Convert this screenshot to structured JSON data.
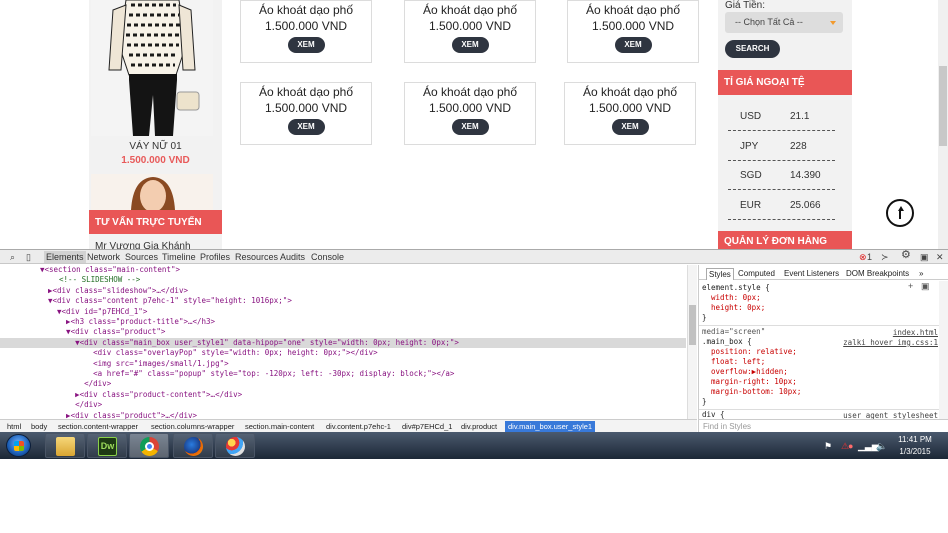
{
  "page": {
    "left_product": {
      "name": "VÁY NỮ 01",
      "price": "1.500.000 VND"
    },
    "left_banner": "TƯ VẤN TRỰC TUYẾN",
    "support_name": "Mr Vương Gia Khánh",
    "cards": [
      {
        "name": "Áo khoát dạo phố",
        "price": "1.500.000 VND",
        "button": "XEM"
      },
      {
        "name": "Áo khoát dạo phố",
        "price": "1.500.000 VND",
        "button": "XEM"
      },
      {
        "name": "Áo khoát dạo phố",
        "price": "1.500.000 VND",
        "button": "XEM"
      },
      {
        "name": "Áo khoát dạo phố",
        "price": "1.500.000 VND",
        "button": "XEM"
      },
      {
        "name": "Áo khoát dạo phố",
        "price": "1.500.000 VND",
        "button": "XEM"
      },
      {
        "name": "Áo khoát dạo phố",
        "price": "1.500.000 VND",
        "button": "XEM"
      }
    ],
    "price_filter": {
      "label": "Giá Tiền:",
      "select_value": "-- Chọn Tất Cả --",
      "search_button": "SEARCH"
    },
    "rates_banner": "TỈ GIÁ NGOẠI TỆ",
    "rates": [
      {
        "code": "USD",
        "value": "21.1"
      },
      {
        "code": "JPY",
        "value": "228"
      },
      {
        "code": "SGD",
        "value": "14.390"
      },
      {
        "code": "EUR",
        "value": "25.066"
      }
    ],
    "orders_banner": "QUẢN LÝ ĐƠN HÀNG",
    "accent_color": "#e95656"
  },
  "devtools": {
    "tabs": [
      "Elements",
      "Network",
      "Sources",
      "Timeline",
      "Profiles",
      "Resources",
      "Audits",
      "Console"
    ],
    "active_tab": "Elements",
    "error_count": "1",
    "dom_lines": [
      "▼<section class=\"main-content\">",
      "  <!-- SLIDESHOW -->",
      "▶<div class=\"slideshow\">…</div>",
      "▼<div class=\"content p7ehc-1\" style=\"height: 1016px;\">",
      "  ▼<div id=\"p7EHCd_1\">",
      "    ▶<h3 class=\"product-title\">…</h3>",
      "    ▼<div class=\"product\">",
      "      ▼<div class=\"main_box user_style1\" data-hipop=\"one\" style=\"width: 0px; height: 0px;\">",
      "          <div class=\"overlayPop\" style=\"width: 0px; height: 0px;\"></div>",
      "          <img src=\"images/small/1.jpg\">",
      "          <a href=\"#\" class=\"popup\" style=\"top: -120px; left: -30px; display: block;\"></a>",
      "        </div>",
      "      ▶<div class=\"product-content\">…</div>",
      "      </div>",
      "    ▶<div class=\"product\">…</div>"
    ],
    "breadcrumbs": [
      "html",
      "body",
      "section.content-wrapper",
      "section.columns-wrapper",
      "section.main-content",
      "div.content.p7ehc-1",
      "div#p7EHCd_1",
      "div.product",
      "div.main_box.user_style1"
    ],
    "styles_tabs": [
      "Styles",
      "Computed",
      "Event Listeners",
      "DOM Breakpoints"
    ],
    "styles_lines": [
      "element.style {",
      "  width: 0px;",
      "  height: 0px;",
      "}",
      "media=\"screen\"",
      ".main_box {",
      "  position: relative;",
      "  float: left;",
      "  overflow:▶hidden;",
      "  margin-right: 10px;",
      "  margin-bottom: 10px;",
      "}",
      "div {"
    ],
    "styles_sources": [
      "index.html",
      "zalki_hover_img.css:1",
      "user agent stylesheet"
    ],
    "find_placeholder": "Find in Styles"
  },
  "taskbar": {
    "apps": [
      "start",
      "explorer",
      "dreamweaver",
      "chrome",
      "firefox",
      "paint"
    ],
    "dreamweaver_label": "Dw",
    "time": "11:41 PM",
    "date": "1/3/2015"
  }
}
